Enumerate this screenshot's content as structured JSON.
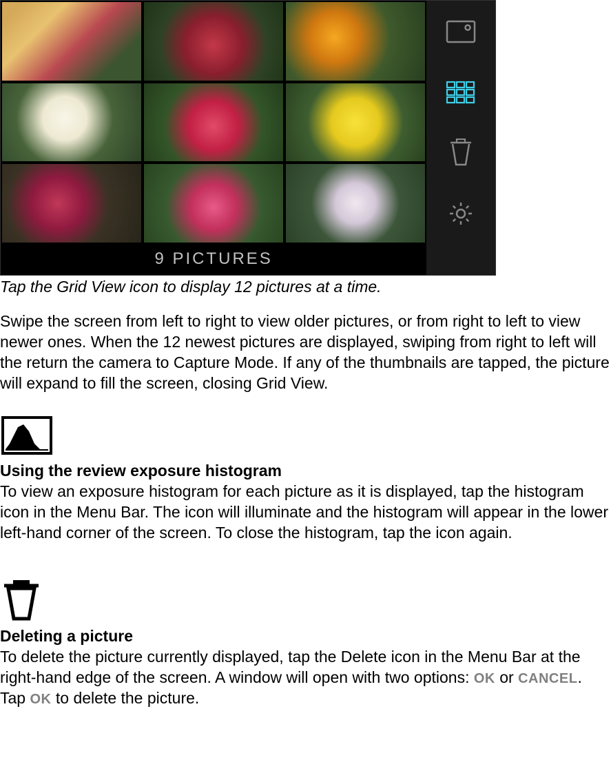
{
  "screenshot": {
    "pictures_label": "9 PICTURES",
    "menu_icons": {
      "camera": "camera-icon",
      "grid": "grid-icon",
      "trash": "trash-icon",
      "settings": "gear-icon"
    }
  },
  "caption": "Tap the Grid View icon to display 12 pictures at a time.",
  "paragraph_swipe": "Swipe the screen from left to right to view older pictures, or from right to left to view newer ones. When the 12 newest pictures are displayed, swiping from right to left will the return the camera to Capture Mode. If any of the thumbnails are tapped, the picture will expand to fill the screen, closing Grid View.",
  "histogram": {
    "heading": "Using the review exposure histogram",
    "body": "To view an exposure histogram for each picture as it is displayed, tap the histogram icon in the Menu Bar. The icon will illuminate and the histogram will appear in the lower left-hand corner of the screen. To close the histogram, tap the icon again."
  },
  "deleting": {
    "heading": "Deleting a picture",
    "body_part1": "To delete the picture currently displayed, tap the Delete icon in the Menu Bar at the right-hand edge of the screen. A window will open with two options: ",
    "ok1": "OK",
    "body_part2": " or ",
    "cancel": "CANCEL",
    "body_part3": ". Tap ",
    "ok2": "OK",
    "body_part4": " to delete the picture."
  }
}
